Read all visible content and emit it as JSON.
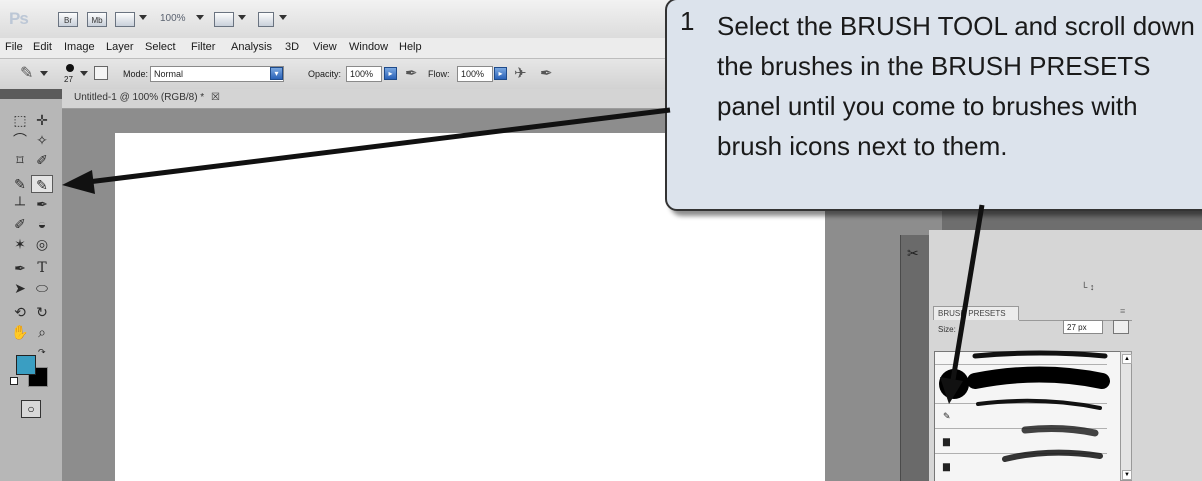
{
  "appbar": {
    "logo": "Ps",
    "icons": [
      "Br",
      "Mb"
    ],
    "zoom": "100%"
  },
  "menu": [
    "File",
    "Edit",
    "Image",
    "Layer",
    "Select",
    "Filter",
    "Analysis",
    "3D",
    "View",
    "Window",
    "Help"
  ],
  "options": {
    "brush_size": "27",
    "mode_label": "Mode:",
    "mode_value": "Normal",
    "opacity_label": "Opacity:",
    "opacity_value": "100%",
    "flow_label": "Flow:",
    "flow_value": "100%"
  },
  "document": {
    "tab_title": "Untitled-1 @ 100% (RGB/8) *",
    "close_glyph": "☒"
  },
  "brush_presets": {
    "tab_label": "BRUSH PRESETS",
    "size_label": "Size:",
    "size_value": "27 px"
  },
  "colors": {
    "foreground": "#3a9ec2",
    "background": "#000000",
    "callout_fill": "#dce3ec"
  },
  "callout": {
    "number": "1",
    "text": "Select the BRUSH TOOL and scroll down the brushes in the BRUSH PRESETS panel until you come to brushes with brush icons next to them."
  }
}
